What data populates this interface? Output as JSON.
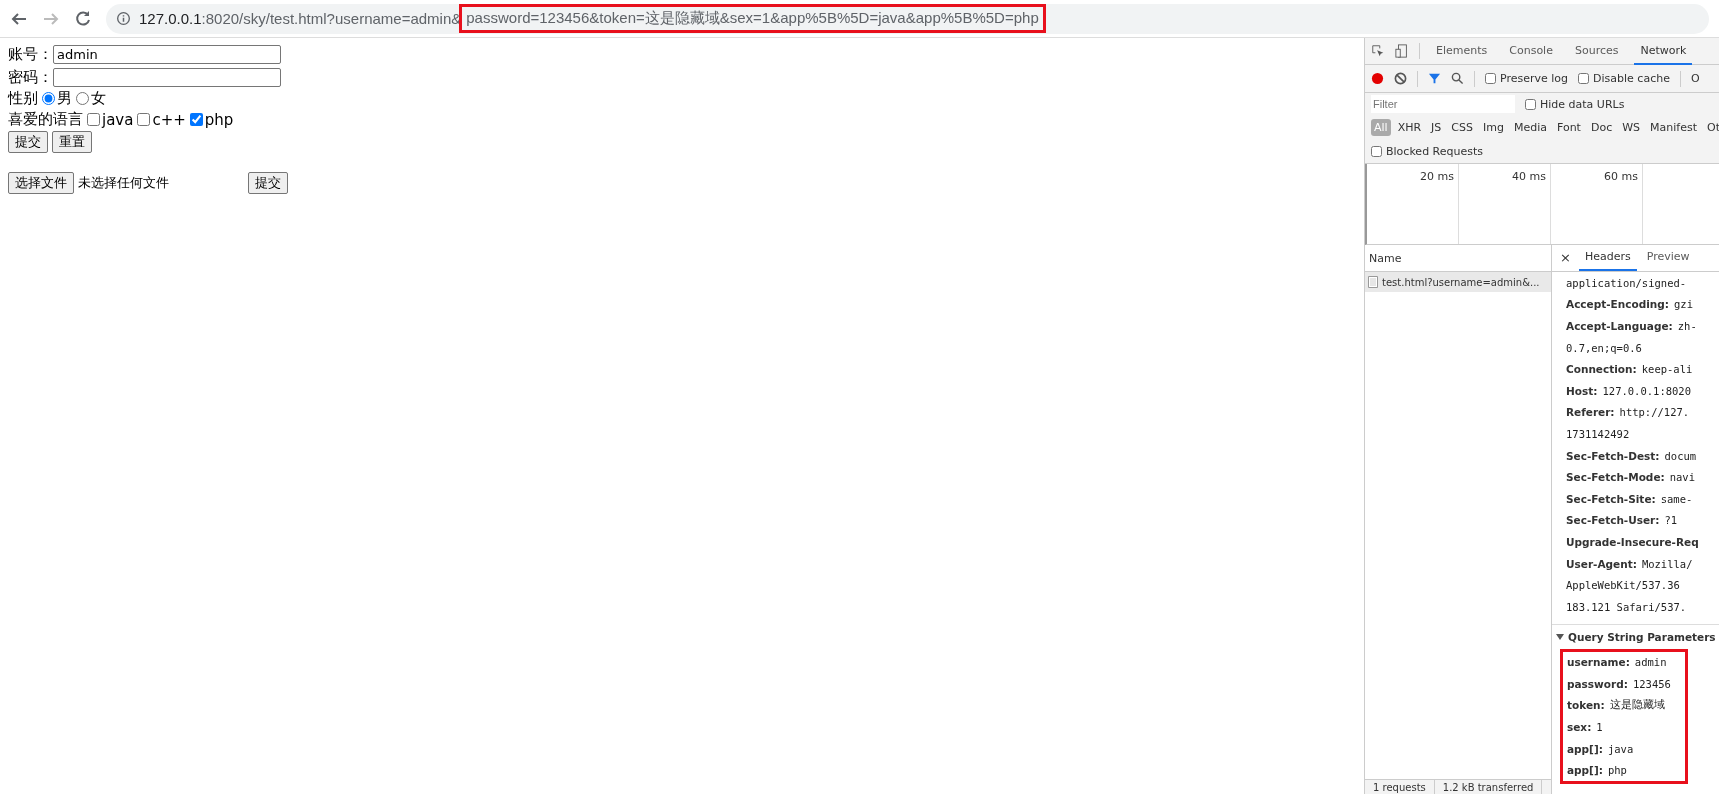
{
  "address_bar": {
    "host": "127.0.0.1",
    "rest": ":8020/sky/test.html?username=admin&",
    "highlighted": "password=123456&token=这是隐藏域&sex=1&app%5B%5D=java&app%5B%5D=php"
  },
  "form": {
    "username_label": "账号：",
    "username_value": "admin",
    "password_label": "密码：",
    "gender_label": "性别",
    "genders": [
      {
        "label": "男",
        "selected": true
      },
      {
        "label": "女",
        "selected": false
      }
    ],
    "language_label": "喜爱的语言",
    "languages": [
      {
        "label": "java",
        "checked": false
      },
      {
        "label": "c++",
        "checked": false
      },
      {
        "label": "php",
        "checked": true
      }
    ],
    "buttons": [
      "提交",
      "重置"
    ],
    "file_button": "选择文件",
    "file_status": "未选择任何文件",
    "file_submit": "提交"
  },
  "devtools": {
    "tabs": [
      {
        "label": "Elements",
        "selected": false
      },
      {
        "label": "Console",
        "selected": false
      },
      {
        "label": "Sources",
        "selected": false
      },
      {
        "label": "Network",
        "selected": true
      }
    ],
    "toolbar_checkboxes": [
      {
        "label": "Preserve log",
        "checked": false
      },
      {
        "label": "Disable cache",
        "checked": false
      }
    ],
    "toolbar_cut": "O",
    "filter_placeholder": "Filter",
    "hide_data_urls": {
      "label": "Hide data URLs",
      "checked": false
    },
    "types": [
      {
        "label": "All",
        "selected": true
      },
      {
        "label": "XHR",
        "selected": false
      },
      {
        "label": "JS",
        "selected": false
      },
      {
        "label": "CSS",
        "selected": false
      },
      {
        "label": "Img",
        "selected": false
      },
      {
        "label": "Media",
        "selected": false
      },
      {
        "label": "Font",
        "selected": false
      },
      {
        "label": "Doc",
        "selected": false
      },
      {
        "label": "WS",
        "selected": false
      },
      {
        "label": "Manifest",
        "selected": false
      },
      {
        "label": "Ot",
        "selected": false
      }
    ],
    "blocked_requests": {
      "label": "Blocked Requests",
      "checked": false
    },
    "timeline_ticks": [
      "20 ms",
      "40 ms",
      "60 ms"
    ],
    "name_header": "Name",
    "requests": [
      {
        "name": "test.html?username=admin&...",
        "selected": true
      }
    ],
    "close_glyph": "×",
    "detail_tabs": [
      {
        "label": "Headers",
        "selected": true
      },
      {
        "label": "Preview",
        "selected": false
      }
    ],
    "headers": [
      {
        "kind": "value",
        "value": "application/signed-"
      },
      {
        "kind": "pair",
        "key": "Accept-Encoding:",
        "value": "gzi"
      },
      {
        "kind": "pair",
        "key": "Accept-Language:",
        "value": "zh-"
      },
      {
        "kind": "value",
        "value": "0.7,en;q=0.6"
      },
      {
        "kind": "pair",
        "key": "Connection:",
        "value": "keep-ali"
      },
      {
        "kind": "pair",
        "key": "Host:",
        "value": "127.0.0.1:8020"
      },
      {
        "kind": "pair",
        "key": "Referer:",
        "value": "http://127."
      },
      {
        "kind": "value",
        "value": "1731142492"
      },
      {
        "kind": "pair",
        "key": "Sec-Fetch-Dest:",
        "value": "docum"
      },
      {
        "kind": "pair",
        "key": "Sec-Fetch-Mode:",
        "value": "navi"
      },
      {
        "kind": "pair",
        "key": "Sec-Fetch-Site:",
        "value": "same-"
      },
      {
        "kind": "pair",
        "key": "Sec-Fetch-User:",
        "value": "?1"
      },
      {
        "kind": "key",
        "key": "Upgrade-Insecure-Req"
      },
      {
        "kind": "pair",
        "key": "User-Agent:",
        "value": "Mozilla/"
      },
      {
        "kind": "value",
        "value": "AppleWebKit/537.36"
      },
      {
        "kind": "value",
        "value": "183.121 Safari/537."
      }
    ],
    "query_title": "Query String Parameters",
    "query_params": [
      {
        "key": "username:",
        "value": "admin"
      },
      {
        "key": "password:",
        "value": "123456"
      },
      {
        "key": "token:",
        "value": "这是隐藏域"
      },
      {
        "key": "sex:",
        "value": "1"
      },
      {
        "key": "app[]:",
        "value": "java"
      },
      {
        "key": "app[]:",
        "value": "php"
      }
    ],
    "status": [
      "1 requests",
      "1.2 kB transferred"
    ]
  }
}
